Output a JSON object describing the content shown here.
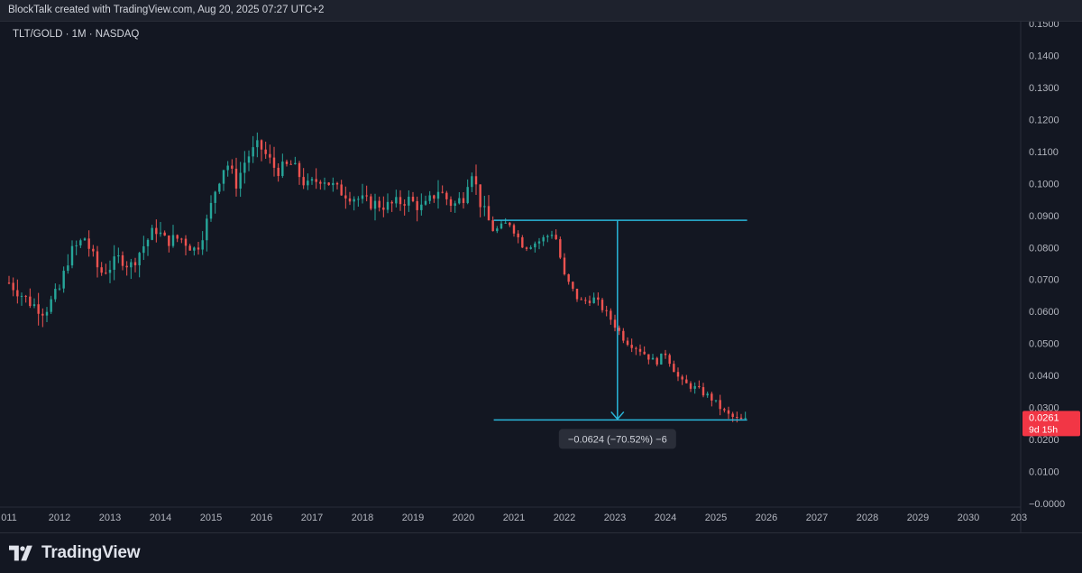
{
  "header": {
    "caption": "BlockTalk created with TradingView.com, Aug 20, 2025 07:27 UTC+2"
  },
  "chart_meta": {
    "symbol_label": "TLT/GOLD · 1M · NASDAQ",
    "measure_label": "−0.0624 (−70.52%) −6",
    "price_tag_value": "0.0261",
    "price_tag_timer": "9d 15h",
    "colors": {
      "background": "#131722",
      "up": "#26a69a",
      "down": "#ef5350",
      "measure": "#29b6d9",
      "price_tag": "#f23645",
      "axis_text": "#b2b5be"
    }
  },
  "footer": {
    "brand": "TradingView",
    "logo_icon": "tradingview-logo-icon"
  },
  "chart_data": {
    "type": "candlestick",
    "timeframe": "1M",
    "y_axis": {
      "ticks": [
        "0.1500",
        "0.1400",
        "0.1300",
        "0.1200",
        "0.1100",
        "0.1000",
        "0.0900",
        "0.0800",
        "0.0700",
        "0.0600",
        "0.0500",
        "0.0400",
        "0.0300",
        "0.0200",
        "0.0100",
        "−0.0000"
      ],
      "range": [
        0.0,
        0.15
      ],
      "position": "right"
    },
    "x_axis": {
      "ticks": [
        "011",
        "2012",
        "2013",
        "2014",
        "2015",
        "2016",
        "2017",
        "2018",
        "2019",
        "2020",
        "2021",
        "2022",
        "2023",
        "2024",
        "2025",
        "2026",
        "2027",
        "2028",
        "2029",
        "2030",
        "203"
      ],
      "range": [
        2011.0,
        2030.9
      ]
    },
    "grid": false,
    "series": [
      {
        "kind": "ohlc_path",
        "start": 2011.0,
        "step_years": 0.0833,
        "anchors": [
          [
            2011.0,
            0.069
          ],
          [
            2011.4,
            0.063
          ],
          [
            2011.7,
            0.06
          ],
          [
            2012.0,
            0.067
          ],
          [
            2012.2,
            0.078
          ],
          [
            2012.5,
            0.083
          ],
          [
            2012.8,
            0.072
          ],
          [
            2013.0,
            0.074
          ],
          [
            2013.2,
            0.077
          ],
          [
            2013.4,
            0.074
          ],
          [
            2013.6,
            0.079
          ],
          [
            2013.9,
            0.086
          ],
          [
            2014.1,
            0.082
          ],
          [
            2014.4,
            0.083
          ],
          [
            2014.7,
            0.079
          ],
          [
            2014.9,
            0.087
          ],
          [
            2015.1,
            0.099
          ],
          [
            2015.3,
            0.107
          ],
          [
            2015.5,
            0.1
          ],
          [
            2015.7,
            0.108
          ],
          [
            2015.95,
            0.112
          ],
          [
            2016.3,
            0.104
          ],
          [
            2016.6,
            0.106
          ],
          [
            2016.9,
            0.099
          ],
          [
            2017.2,
            0.102
          ],
          [
            2017.5,
            0.098
          ],
          [
            2017.8,
            0.096
          ],
          [
            2018.1,
            0.094
          ],
          [
            2018.5,
            0.093
          ],
          [
            2018.9,
            0.095
          ],
          [
            2019.2,
            0.092
          ],
          [
            2019.5,
            0.098
          ],
          [
            2019.8,
            0.093
          ],
          [
            2020.0,
            0.096
          ],
          [
            2020.15,
            0.105
          ],
          [
            2020.35,
            0.093
          ],
          [
            2020.6,
            0.085
          ],
          [
            2020.9,
            0.088
          ],
          [
            2021.2,
            0.08
          ],
          [
            2021.5,
            0.082
          ],
          [
            2021.8,
            0.085
          ],
          [
            2022.0,
            0.071
          ],
          [
            2022.3,
            0.063
          ],
          [
            2022.6,
            0.064
          ],
          [
            2022.9,
            0.058
          ],
          [
            2023.2,
            0.051
          ],
          [
            2023.5,
            0.048
          ],
          [
            2023.8,
            0.044
          ],
          [
            2024.0,
            0.047
          ],
          [
            2024.3,
            0.038
          ],
          [
            2024.6,
            0.036
          ],
          [
            2024.9,
            0.033
          ],
          [
            2025.2,
            0.028
          ],
          [
            2025.45,
            0.026
          ],
          [
            2025.6,
            0.0261
          ]
        ]
      }
    ],
    "annotations": {
      "measure_tool": {
        "from_value": 0.0885,
        "to_value": 0.0261,
        "x_start": 2020.6,
        "x_end": 2025.6,
        "arrow_x": 2023.05,
        "label": "−0.0624 (−70.52%) −6"
      },
      "last_price": 0.0261
    }
  }
}
